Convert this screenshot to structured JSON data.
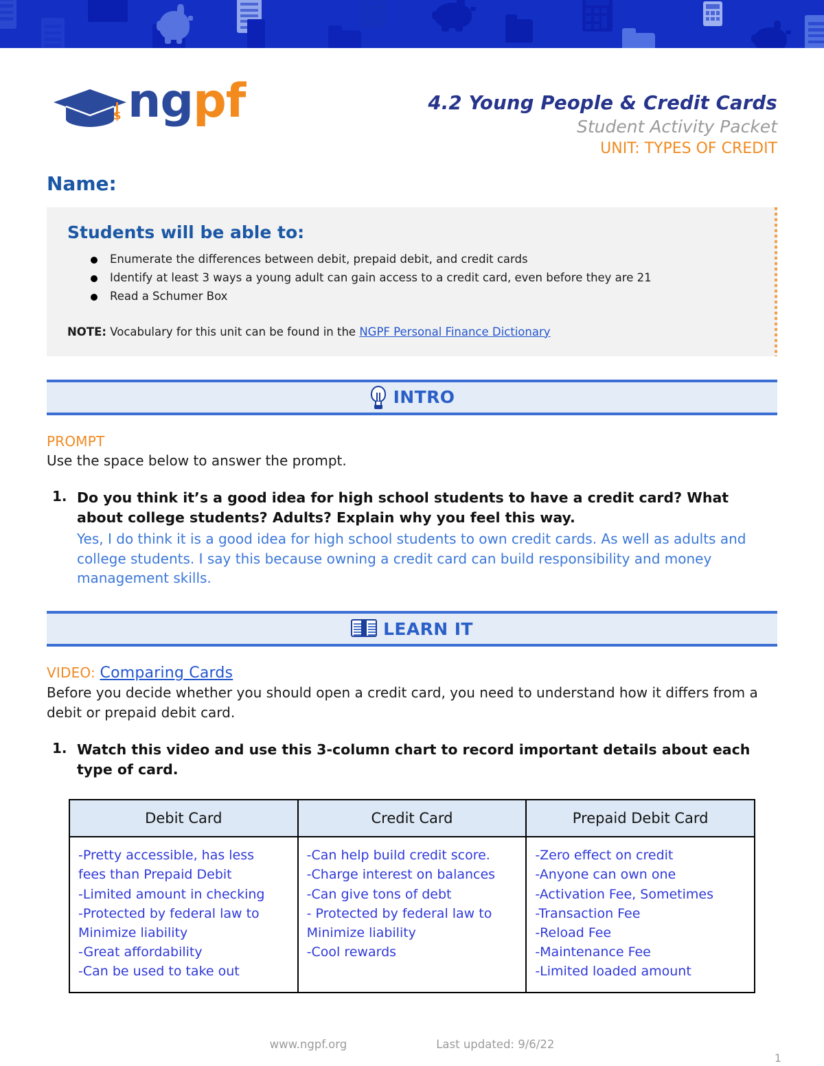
{
  "banner": {
    "background_color": "#1430c4",
    "strip_color": "#101a36",
    "icon_names": [
      "document-icon",
      "piggy-bank-icon",
      "calculator-icon",
      "folder-icon"
    ]
  },
  "logo": {
    "text_ng": "ng",
    "text_pf": "pf",
    "cap_color": "#2b4a9b",
    "accent_color": "#f28a1e",
    "tassel_symbol": "$"
  },
  "header": {
    "title": "4.2 Young People & Credit Cards",
    "subtitle": "Student Activity Packet",
    "unit": "UNIT: TYPES OF CREDIT",
    "title_color": "#26348c",
    "subtitle_color": "#9a9a9a",
    "unit_color": "#f08a22"
  },
  "name_field": {
    "label": "Name:",
    "value": ""
  },
  "objectives": {
    "heading": "Students will be able to:",
    "items": [
      "Enumerate the differences between debit, prepaid debit, and credit cards",
      "Identify at least 3 ways a young adult can gain access to a credit card, even before they are 21",
      "Read a Schumer Box"
    ],
    "note_label": "NOTE:",
    "note_text": " Vocabulary for this unit can be found in the ",
    "note_link": "NGPF Personal Finance Dictionary"
  },
  "intro_section": {
    "icon": "lightbulb-icon",
    "label": "INTRO",
    "kicker": "PROMPT",
    "instruction": "Use the space below to answer the prompt.",
    "questions": [
      {
        "number": "1.",
        "text": "Do you think it’s a good idea for high school students to have a credit card? What about college students? Adults? Explain why you feel this way.",
        "answer": "Yes, I do think it is a good idea for high school students to own credit cards. As well as adults and college students. I say this because owning a credit card can build responsibility and money management skills."
      }
    ]
  },
  "learn_section": {
    "icon": "open-book-icon",
    "label": "LEARN IT",
    "kicker_prefix": "VIDEO: ",
    "kicker_link": "Comparing Cards",
    "paragraph": "Before you decide whether you should open a credit card, you need to understand how it differs from a debit or prepaid debit card.",
    "questions": [
      {
        "number": "1.",
        "text": "Watch this video and use this 3-column chart to record important details about each type of card."
      }
    ]
  },
  "chart_data": {
    "type": "table",
    "title": "3-column card comparison chart",
    "columns": [
      "Debit Card",
      "Credit Card",
      "Prepaid Debit Card"
    ],
    "header_background": "#dce8f5",
    "answer_color": "#2f39d8",
    "rows": [
      {
        "debit_card": [
          "-Pretty accessible, has less",
          "fees than Prepaid Debit",
          "-Limited amount in checking",
          "-Protected by federal law to",
          "Minimize liability",
          "-Great affordability",
          "-Can be used to take out"
        ],
        "credit_card": [
          "-Can help build credit score.",
          "-Charge interest on balances",
          "-Can give tons of debt",
          "- Protected by federal law to",
          "Minimize liability",
          "-Cool rewards"
        ],
        "prepaid_debit_card": [
          "-Zero effect on credit",
          "-Anyone can own one",
          "-Activation Fee, Sometimes",
          "-Transaction Fee",
          "-Reload Fee",
          "-Maintenance Fee",
          "-Limited loaded amount"
        ]
      }
    ]
  },
  "footer": {
    "website": "www.ngpf.org",
    "last_updated": "Last updated: 9/6/22",
    "page_number": "1"
  }
}
